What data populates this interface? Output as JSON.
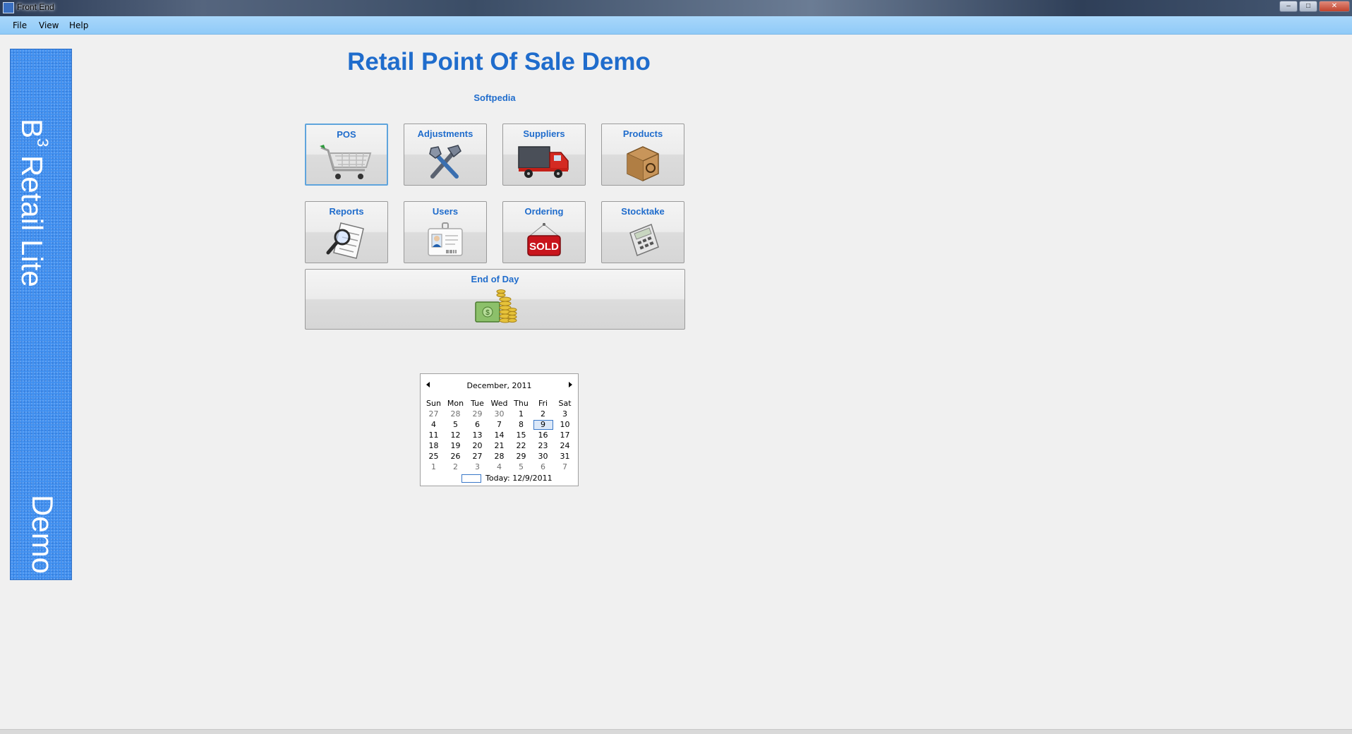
{
  "window": {
    "title": "Front End",
    "controls": {
      "minimize": "–",
      "maximize": "□",
      "close": "✕"
    }
  },
  "menu": {
    "items": [
      "File",
      "View",
      "Help"
    ]
  },
  "banner": {
    "product": "B",
    "superscript": "3",
    "product_rest": " Retail Lite",
    "edition": "Demo"
  },
  "header": {
    "title": "Retail Point Of Sale Demo",
    "subtitle": "Softpedia"
  },
  "tiles": [
    {
      "label": "POS",
      "icon": "cart-icon"
    },
    {
      "label": "Adjustments",
      "icon": "tools-icon"
    },
    {
      "label": "Suppliers",
      "icon": "truck-icon"
    },
    {
      "label": "Products",
      "icon": "box-icon"
    },
    {
      "label": "Reports",
      "icon": "report-magnifier-icon"
    },
    {
      "label": "Users",
      "icon": "id-card-icon"
    },
    {
      "label": "Ordering",
      "icon": "sold-sign-icon",
      "icon_text": "SOLD"
    },
    {
      "label": "Stocktake",
      "icon": "calculator-icon"
    },
    {
      "label": "End of Day",
      "icon": "money-icon"
    }
  ],
  "calendar": {
    "month": "December, 2011",
    "weekdays": [
      "Sun",
      "Mon",
      "Tue",
      "Wed",
      "Thu",
      "Fri",
      "Sat"
    ],
    "weeks": [
      [
        "27",
        "28",
        "29",
        "30",
        "1",
        "2",
        "3"
      ],
      [
        "4",
        "5",
        "6",
        "7",
        "8",
        "9",
        "10"
      ],
      [
        "11",
        "12",
        "13",
        "14",
        "15",
        "16",
        "17"
      ],
      [
        "18",
        "19",
        "20",
        "21",
        "22",
        "23",
        "24"
      ],
      [
        "25",
        "26",
        "27",
        "28",
        "29",
        "30",
        "31"
      ],
      [
        "1",
        "2",
        "3",
        "4",
        "5",
        "6",
        "7"
      ]
    ],
    "selected": "9",
    "today_label": "Today: 12/9/2011"
  },
  "colors": {
    "accent": "#1f6ccc",
    "menubar": "#99cff9",
    "banner": "#3f8ff0"
  }
}
